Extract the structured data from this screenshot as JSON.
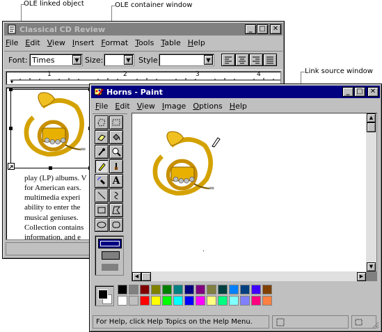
{
  "annotations": {
    "ole_linked_object": "OLE linked object",
    "ole_container_window": "OLE container window",
    "link_source_window": "Link source window"
  },
  "container": {
    "title": "Classical CD Review",
    "menu": [
      "File",
      "Edit",
      "View",
      "Insert",
      "Format",
      "Tools",
      "Table",
      "Help"
    ],
    "font_label": "Font:",
    "font_value": "Times",
    "size_label": "Size:",
    "style_label": "Style:",
    "ruler_numbers": [
      "1",
      "2",
      "3",
      "4"
    ],
    "text_lines": [
      "play (LP) albums.  V",
      "for American ears.",
      "multimedia  experi",
      "ability to enter the",
      "musical   geniuses.",
      "Collection contains",
      "information,  and  e"
    ]
  },
  "paint": {
    "title": "Horns - Paint",
    "menu": [
      "File",
      "Edit",
      "View",
      "Image",
      "Options",
      "Help"
    ],
    "status_text": "For Help, click Help Topics on the Help Menu.",
    "palette_colors_top": [
      "#000000",
      "#808080",
      "#800000",
      "#808000",
      "#008000",
      "#008080",
      "#000080",
      "#800080",
      "#808040",
      "#004040",
      "#0080ff",
      "#004080",
      "#4000ff",
      "#804000"
    ],
    "palette_colors_bottom": [
      "#ffffff",
      "#c0c0c0",
      "#ff0000",
      "#ffff00",
      "#00ff00",
      "#00ffff",
      "#0000ff",
      "#ff00ff",
      "#ffff80",
      "#00ff80",
      "#80ffff",
      "#8080ff",
      "#ff0080",
      "#ff8040"
    ],
    "fg_color": "#000000",
    "bg_color": "#ffffff",
    "icons": {
      "paint_app": "paint-app-icon",
      "container_app": "document-app-icon",
      "link_badge": "link-badge-icon"
    },
    "tools": [
      "free-form-select-icon",
      "select-icon",
      "eraser-icon",
      "fill-icon",
      "pick-color-icon",
      "magnifier-icon",
      "pencil-icon",
      "brush-icon",
      "airbrush-icon",
      "text-icon",
      "line-icon",
      "curve-icon",
      "rectangle-icon",
      "polygon-icon",
      "ellipse-icon",
      "rounded-rectangle-icon"
    ],
    "text_tool_glyph": "A"
  },
  "accent": {
    "active_title": "#000080",
    "inactive_title": "#808080",
    "face": "#c0c0c0"
  }
}
